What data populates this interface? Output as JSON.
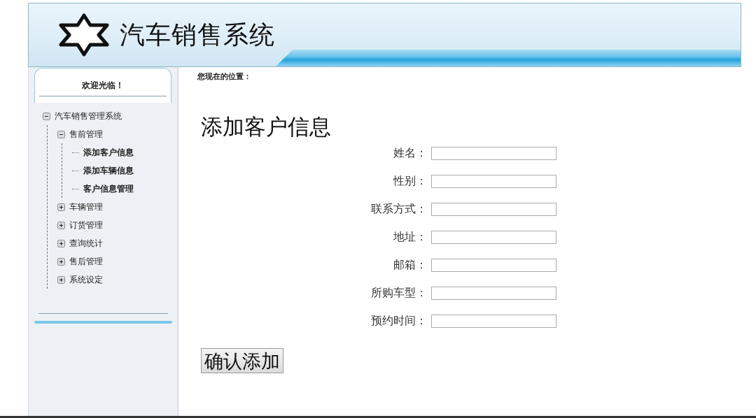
{
  "header": {
    "title": "汽车销售系统"
  },
  "sidebar": {
    "welcome": "欢迎光临！",
    "tree": [
      {
        "label": "汽车销售管理系统",
        "expanded": true,
        "children": [
          {
            "label": "售前管理",
            "expanded": true,
            "children": [
              {
                "label": "添加客户信息"
              },
              {
                "label": "添加车辆信息"
              },
              {
                "label": "客户信息管理"
              }
            ]
          },
          {
            "label": "车辆管理",
            "expanded": false
          },
          {
            "label": "订货管理",
            "expanded": false
          },
          {
            "label": "查询统计",
            "expanded": false
          },
          {
            "label": "售后管理",
            "expanded": false
          },
          {
            "label": "系统设定",
            "expanded": false
          }
        ]
      }
    ]
  },
  "breadcrumb": "您现在的位置：",
  "form": {
    "title": "添加客户信息",
    "fields": [
      {
        "label": "姓名："
      },
      {
        "label": "性别："
      },
      {
        "label": "联系方式："
      },
      {
        "label": "地址："
      },
      {
        "label": "邮箱："
      },
      {
        "label": "所购车型："
      },
      {
        "label": "预约时间："
      }
    ],
    "submit": "确认添加"
  }
}
